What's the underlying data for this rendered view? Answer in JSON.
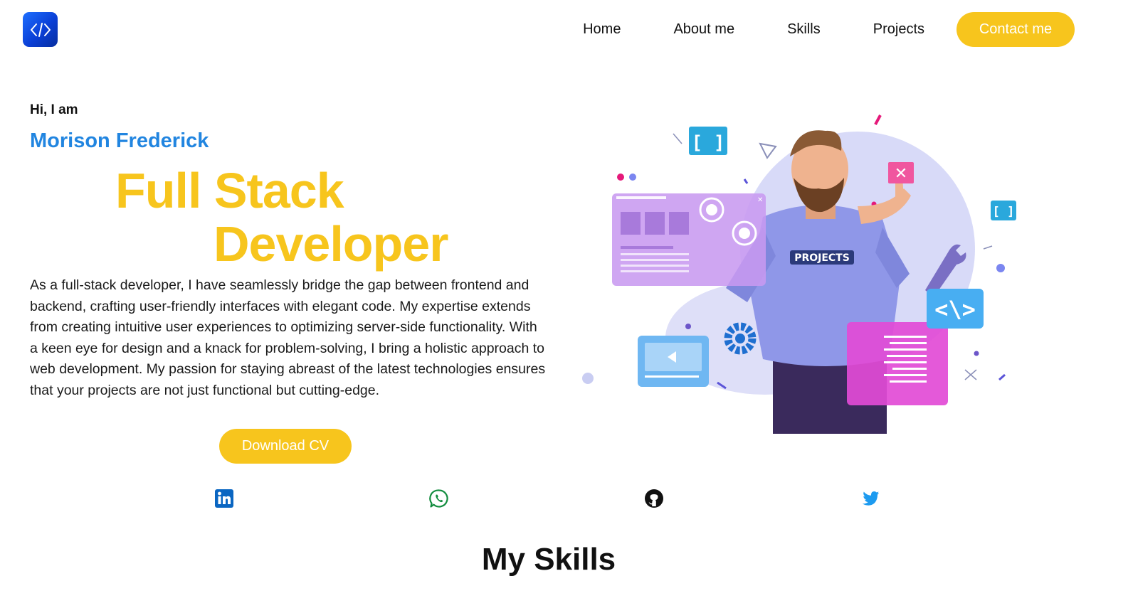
{
  "header": {
    "logo_icon": "code-brackets-icon",
    "nav": [
      "Home",
      "About me",
      "Skills",
      "Projects"
    ],
    "contact_label": "Contact me"
  },
  "hero": {
    "greeting": "Hi, I am",
    "name": "Morison Frederick",
    "title_line1": "Full Stack",
    "title_line2": "Developer",
    "bio": "As a full-stack developer, I have seamlessly bridge the gap between frontend and backend, crafting user-friendly interfaces with elegant code. My expertise extends from creating intuitive user experiences to optimizing server-side functionality. With a keen eye for design and a knack for problem-solving, I bring a holistic approach to web development. My passion for staying abreast of the latest technologies ensures that your projects are not just functional but cutting-edge.",
    "cv_label": "Download CV",
    "illustration_shirt_text": "PROJECTS"
  },
  "social": [
    {
      "icon": "linkedin-icon",
      "color": "#0a66c2"
    },
    {
      "icon": "whatsapp-icon",
      "color": "#128c3e"
    },
    {
      "icon": "github-icon",
      "color": "#111111"
    },
    {
      "icon": "twitter-icon",
      "color": "#1d9bf0"
    }
  ],
  "skills": {
    "title": "My Skills"
  },
  "colors": {
    "accent": "#f7c51d",
    "name_blue": "#2185e0",
    "logo_blue": "#0a3fd6"
  }
}
